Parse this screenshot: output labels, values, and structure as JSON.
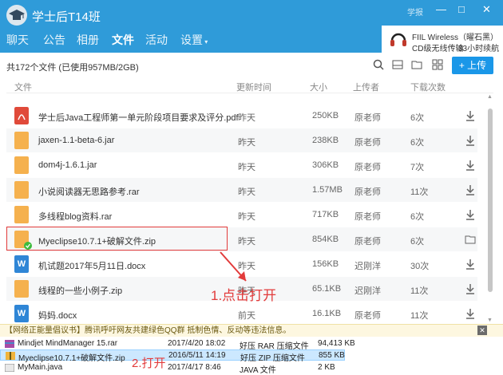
{
  "window": {
    "title": "学士后T14班",
    "extra": "学报",
    "controls": [
      "—",
      "□",
      "✕"
    ]
  },
  "tabs": [
    {
      "label": "聊天"
    },
    {
      "label": "公告"
    },
    {
      "label": "相册"
    },
    {
      "label": "文件",
      "active": true
    },
    {
      "label": "活动"
    },
    {
      "label": "设置"
    }
  ],
  "music": {
    "title": "FIIL Wireless（曜石黑）",
    "subtitle": "CD级无线传输",
    "promo": "33小时续航"
  },
  "toolbar": {
    "summary": "共172个文件 (已使用957MB/2GB)",
    "upload_label": "+ 上传"
  },
  "columns": {
    "file": "文件",
    "time": "更新时间",
    "size": "大小",
    "uploader": "上传者",
    "downloads": "下载次数"
  },
  "files": [
    {
      "icon": "pdf-icon",
      "name": "学士后Java工程师第一单元阶段项目要求及评分.pdf",
      "time": "昨天",
      "size": "250KB",
      "uploader": "原老师",
      "count": "6次"
    },
    {
      "icon": "folder-icon",
      "name": "jaxen-1.1-beta-6.jar",
      "time": "昨天",
      "size": "238KB",
      "uploader": "原老师",
      "count": "6次"
    },
    {
      "icon": "folder-icon",
      "name": "dom4j-1.6.1.jar",
      "time": "昨天",
      "size": "306KB",
      "uploader": "原老师",
      "count": "7次"
    },
    {
      "icon": "folder-icon",
      "name": "小说阅读器无思路参考.rar",
      "time": "昨天",
      "size": "1.57MB",
      "uploader": "原老师",
      "count": "11次"
    },
    {
      "icon": "folder-icon",
      "name": "多线程blog资料.rar",
      "time": "昨天",
      "size": "717KB",
      "uploader": "原老师",
      "count": "6次"
    },
    {
      "icon": "folder-icon",
      "name": "Myeclipse10.7.1+破解文件.zip",
      "time": "昨天",
      "size": "854KB",
      "uploader": "原老师",
      "count": "6次"
    },
    {
      "icon": "word-icon",
      "name": "机试题2017年5月11日.docx",
      "time": "昨天",
      "size": "156KB",
      "uploader": "迟刚洋",
      "count": "30次"
    },
    {
      "icon": "folder-icon",
      "name": "线程的一些小例子.zip",
      "time": "昨天",
      "size": "65.1KB",
      "uploader": "迟刚洋",
      "count": "11次"
    },
    {
      "icon": "word-icon",
      "name": "妈妈.docx",
      "time": "前天",
      "size": "16.1KB",
      "uploader": "原老师",
      "count": "11次"
    }
  ],
  "notice": "【网络正能量倡议书】腾讯呼吁网友共建绿色QQ群 抵制色情、反动等违法信息。",
  "annotations": {
    "step1": "1.点击打开",
    "step2": "2.打开"
  },
  "explorer": [
    {
      "name": "Mindjet MindManager 15.rar",
      "date": "2017/4/20 18:02",
      "type": "好压 RAR 压缩文件",
      "size": "94,413 KB"
    },
    {
      "name": "Myeclipse10.7.1+破解文件.zip",
      "date": "2016/5/11 14:19",
      "type": "好压 ZIP 压缩文件",
      "size": "855 KB",
      "selected": true
    },
    {
      "name": "MyMain.java",
      "date": "2017/4/17 8:46",
      "type": "JAVA 文件",
      "size": "2 KB"
    }
  ],
  "colors": {
    "header": "#2f9bd9",
    "upload": "#1a97e8",
    "annotation": "#e23b3b"
  }
}
